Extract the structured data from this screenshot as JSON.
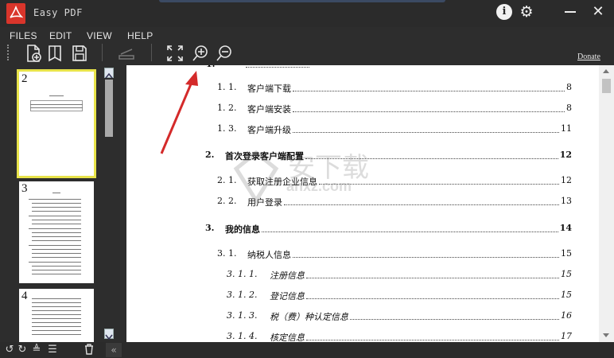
{
  "window": {
    "title": "Easy PDF"
  },
  "menu": [
    "FILES",
    "EDIT",
    "VIEW",
    "HELP"
  ],
  "toolbar": {
    "donate_label": "Donate"
  },
  "thumbnails": [
    {
      "page": "2",
      "selected": true
    },
    {
      "page": "3",
      "selected": false
    },
    {
      "page": "4",
      "selected": false
    }
  ],
  "toc": [
    {
      "num": "1. 1.",
      "text": "客户端下载",
      "page": "8",
      "style": "normal"
    },
    {
      "num": "1. 2.",
      "text": "客户端安装",
      "page": "8",
      "style": "normal"
    },
    {
      "num": "1. 3.",
      "text": "客户端升级",
      "page": "11",
      "style": "normal"
    },
    {
      "num": "2.",
      "text": "首次登录客户端配置",
      "page": "12",
      "style": "bold"
    },
    {
      "num": "2. 1.",
      "text": "获取注册企业信息",
      "page": "12",
      "style": "normal"
    },
    {
      "num": "2. 2.",
      "text": "用户登录",
      "page": "13",
      "style": "normal"
    },
    {
      "num": "3.",
      "text": "我的信息",
      "page": "14",
      "style": "bold"
    },
    {
      "num": "3. 1.",
      "text": "纳税人信息",
      "page": "15",
      "style": "normal"
    },
    {
      "num": "3. 1. 1.",
      "text": "注册信息",
      "page": "15",
      "style": "italic"
    },
    {
      "num": "3. 1. 2.",
      "text": "登记信息",
      "page": "15",
      "style": "italic"
    },
    {
      "num": "3. 1. 3.",
      "text": "税（费）种认定信息",
      "page": "16",
      "style": "italic"
    },
    {
      "num": "3. 1. 4.",
      "text": "核定信息",
      "page": "17",
      "style": "italic"
    }
  ],
  "watermark": {
    "text": "anxz.com"
  },
  "colors": {
    "accent_logo": "#d9352b",
    "selection": "#e8e34a",
    "annotation_arrow": "#d42a2a"
  }
}
